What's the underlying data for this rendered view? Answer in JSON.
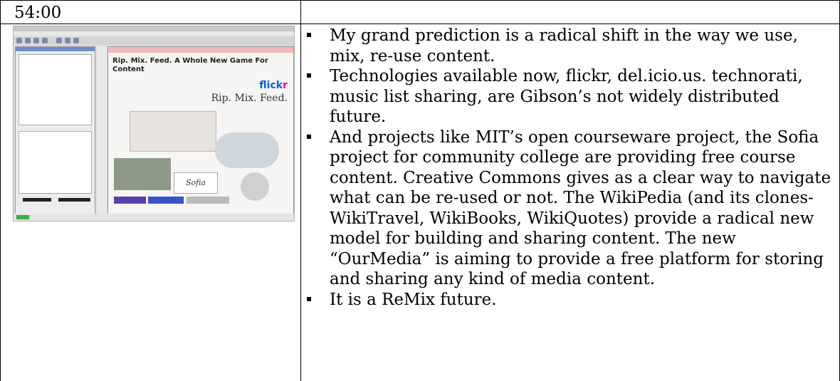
{
  "timestamp": "54:00",
  "thumbnail": {
    "slide_title": "Rip. Mix. Feed. A Whole New Game For Content",
    "logo_text_a": "flick",
    "logo_text_b": "r",
    "slide_text": "Rip. Mix. Feed.",
    "sofia_text": "Sofia"
  },
  "bullets": [
    "My grand prediction is a radical shift in the way we use, mix, re-use content.",
    "Technologies available now, flickr, del.icio.us. technorati, music list sharing, are Gibson’s not widely distributed future.",
    "And projects like MIT’s open courseware project, the Sofia project for community college are providing free course content. Creative Commons gives as a clear way to navigate what can be re-used or not. The WikiPedia (and its clones- WikiTravel, WikiBooks, WikiQuotes) provide a radical new model for building and sharing content. The new “OurMedia” is aiming to provide a free platform for storing and sharing any kind of media content.",
    "It is a ReMix future."
  ]
}
